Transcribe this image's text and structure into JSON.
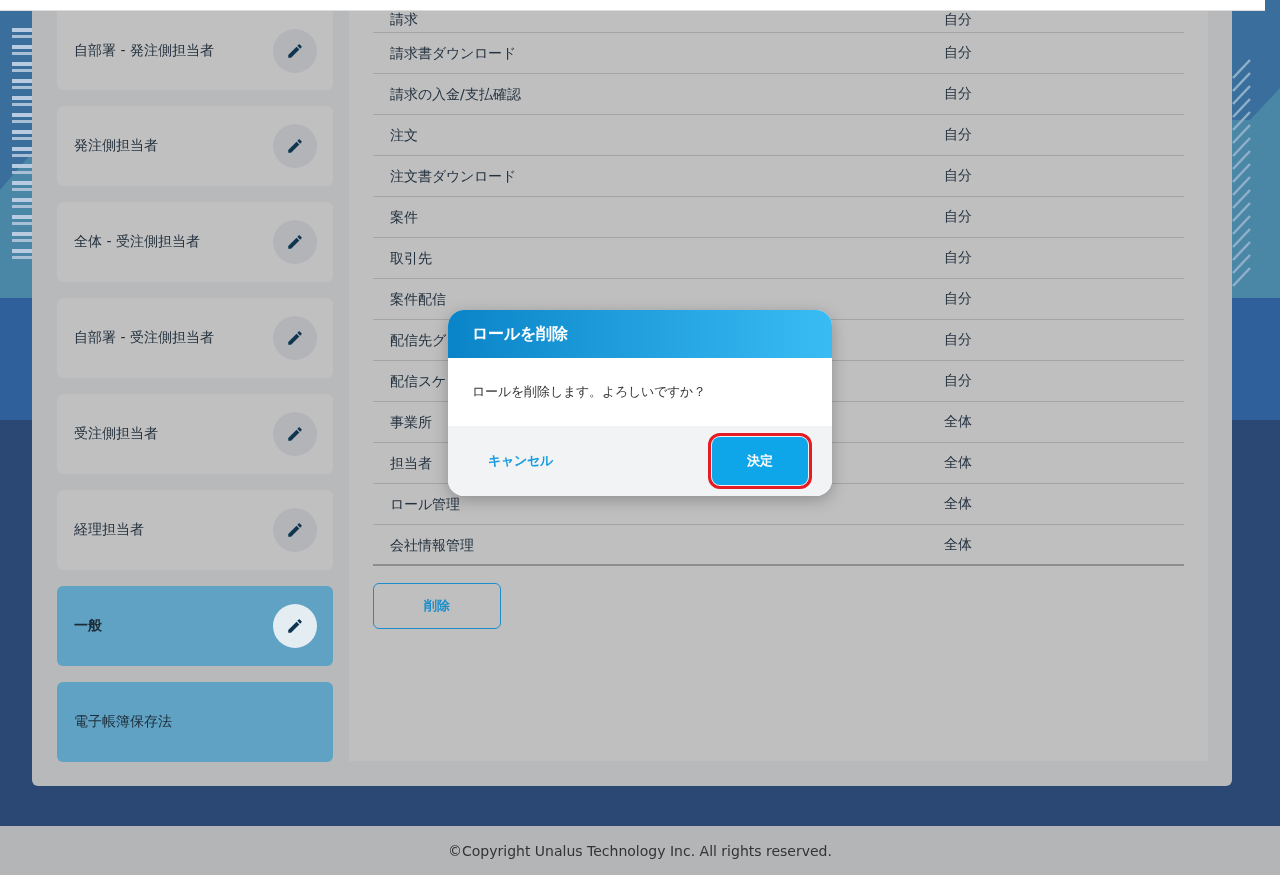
{
  "roles": [
    {
      "name": "自部署 - 発注側担当者",
      "kind": "custom",
      "selected": false,
      "editable": true
    },
    {
      "name": "発注側担当者",
      "kind": "custom",
      "selected": false,
      "editable": true
    },
    {
      "name": "全体 - 受注側担当者",
      "kind": "custom",
      "selected": false,
      "editable": true
    },
    {
      "name": "自部署 - 受注側担当者",
      "kind": "custom",
      "selected": false,
      "editable": true
    },
    {
      "name": "受注側担当者",
      "kind": "custom",
      "selected": false,
      "editable": true
    },
    {
      "name": "経理担当者",
      "kind": "custom",
      "selected": false,
      "editable": true
    },
    {
      "name": "一般",
      "kind": "preset",
      "selected": true,
      "editable": true
    },
    {
      "name": "電子帳簿保存法",
      "kind": "preset",
      "selected": false,
      "editable": false
    }
  ],
  "permissions": [
    {
      "feature": "請求",
      "scope": "自分"
    },
    {
      "feature": "請求書ダウンロード",
      "scope": "自分"
    },
    {
      "feature": "請求の入金/支払確認",
      "scope": "自分"
    },
    {
      "feature": "注文",
      "scope": "自分"
    },
    {
      "feature": "注文書ダウンロード",
      "scope": "自分"
    },
    {
      "feature": "案件",
      "scope": "自分"
    },
    {
      "feature": "取引先",
      "scope": "自分"
    },
    {
      "feature": "案件配信",
      "scope": "自分"
    },
    {
      "feature": "配信先グ",
      "scope": "自分"
    },
    {
      "feature": "配信スケ",
      "scope": "自分"
    },
    {
      "feature": "事業所",
      "scope": "全体"
    },
    {
      "feature": "担当者",
      "scope": "全体"
    },
    {
      "feature": "ロール管理",
      "scope": "全体"
    },
    {
      "feature": "会社情報管理",
      "scope": "全体"
    }
  ],
  "delete_button": "削除",
  "dialog": {
    "title": "ロールを削除",
    "message": "ロールを削除します。よろしいですか？",
    "cancel": "キャンセル",
    "confirm": {
      "label": "決定",
      "highlighted": true
    }
  },
  "footer": "©Copyright Unalus Technology Inc. All rights reserved."
}
